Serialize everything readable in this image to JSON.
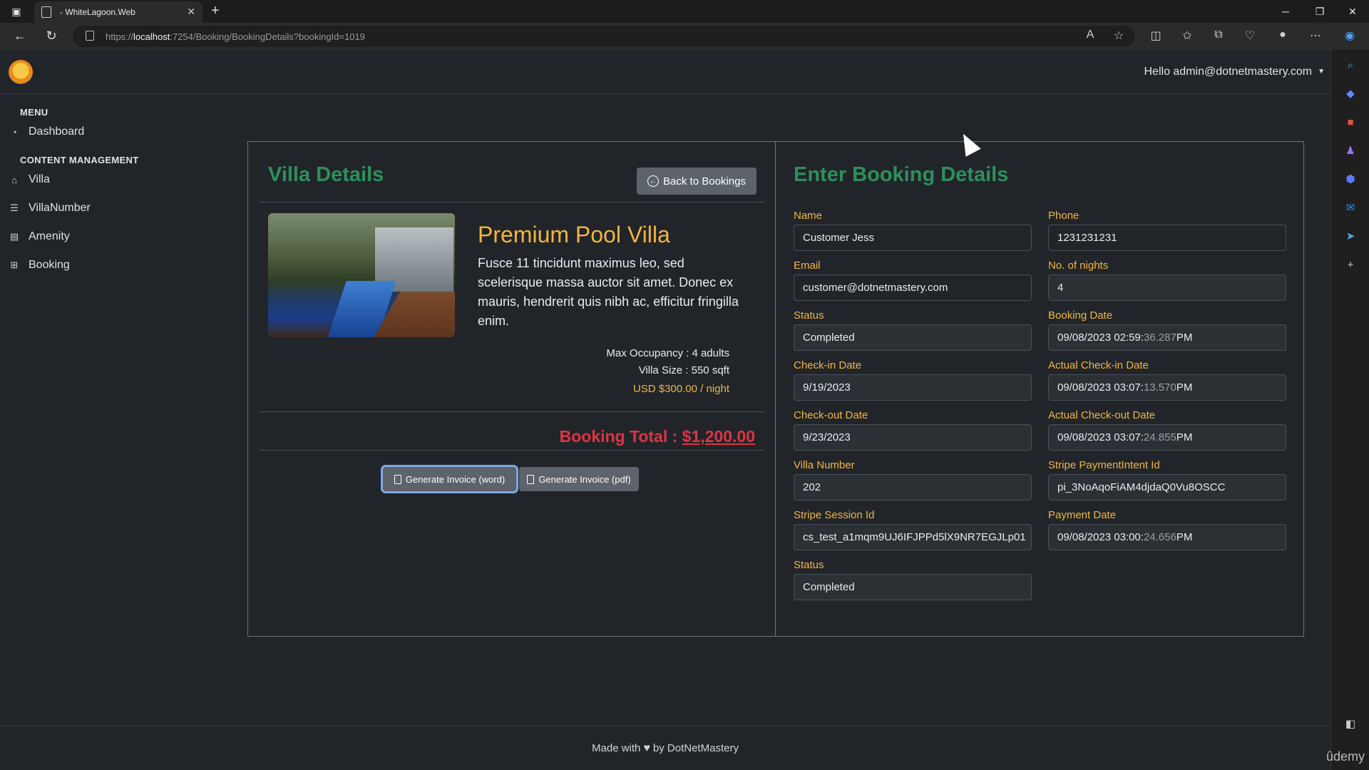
{
  "browser": {
    "tab_title": "- WhiteLagoon.Web",
    "url_prefix": "https://",
    "url_host": "localhost",
    "url_rest": ":7254/Booking/BookingDetails?bookingId=1019"
  },
  "header": {
    "greeting": "Hello admin@dotnetmastery.com"
  },
  "sidebar": {
    "menu_heading": "MENU",
    "content_heading": "CONTENT MANAGEMENT",
    "items": [
      {
        "label": "Dashboard",
        "icon": "dashboard-icon"
      },
      {
        "label": "Villa",
        "icon": "home-icon"
      },
      {
        "label": "VillaNumber",
        "icon": "list-icon"
      },
      {
        "label": "Amenity",
        "icon": "building-icon"
      },
      {
        "label": "Booking",
        "icon": "plus-square-icon"
      }
    ]
  },
  "villa": {
    "section_title": "Villa Details",
    "back_label": "Back to Bookings",
    "name": "Premium Pool Villa",
    "description": "Fusce 11 tincidunt maximus leo, sed scelerisque massa auctor sit amet. Donec ex mauris, hendrerit quis nibh ac, efficitur fringilla enim.",
    "occupancy": "Max Occupancy : 4 adults",
    "size": "Villa Size : 550 sqft",
    "price": "USD $300.00 / night",
    "total_label": "Booking Total : ",
    "total_value": "$1,200.00",
    "invoice_word": "Generate Invoice (word)",
    "invoice_pdf": "Generate Invoice (pdf)"
  },
  "booking": {
    "section_title": "Enter Booking Details",
    "name_label": "Name",
    "name": "Customer Jess",
    "phone_label": "Phone",
    "phone": "1231231231",
    "email_label": "Email",
    "email": "customer@dotnetmastery.com",
    "nights_label": "No. of nights",
    "nights": "4",
    "status_label": "Status",
    "status": "Completed",
    "booking_date_label": "Booking Date",
    "booking_date_a": "09/08/2023 02:59:",
    "booking_date_b": "36.287",
    "booking_date_c": " PM",
    "checkin_label": "Check-in Date",
    "checkin": "9/19/2023",
    "actual_checkin_label": "Actual Check-in Date",
    "actual_checkin_a": "09/08/2023 03:07:",
    "actual_checkin_b": "13.570",
    "actual_checkin_c": " PM",
    "checkout_label": "Check-out Date",
    "checkout": "9/23/2023",
    "actual_checkout_label": "Actual Check-out Date",
    "actual_checkout_a": "09/08/2023 03:07:",
    "actual_checkout_b": "24.855",
    "actual_checkout_c": " PM",
    "villa_number_label": "Villa Number",
    "villa_number": "202",
    "payment_intent_label": "Stripe PaymentIntent Id",
    "payment_intent": "pi_3NoAqoFiAM4djdaQ0Vu8OSCC",
    "session_label": "Stripe Session Id",
    "session": "cs_test_a1mqm9UJ6IFJPPd5lX9NR7EGJLp01",
    "payment_date_label": "Payment Date",
    "payment_date_a": "09/08/2023 03:00:",
    "payment_date_b": "24.656",
    "payment_date_c": " PM",
    "status2_label": "Status",
    "status2": "Completed"
  },
  "footer": {
    "made_with": "Made with",
    "by": "by DotNetMastery",
    "watermark": "ûdemy"
  }
}
